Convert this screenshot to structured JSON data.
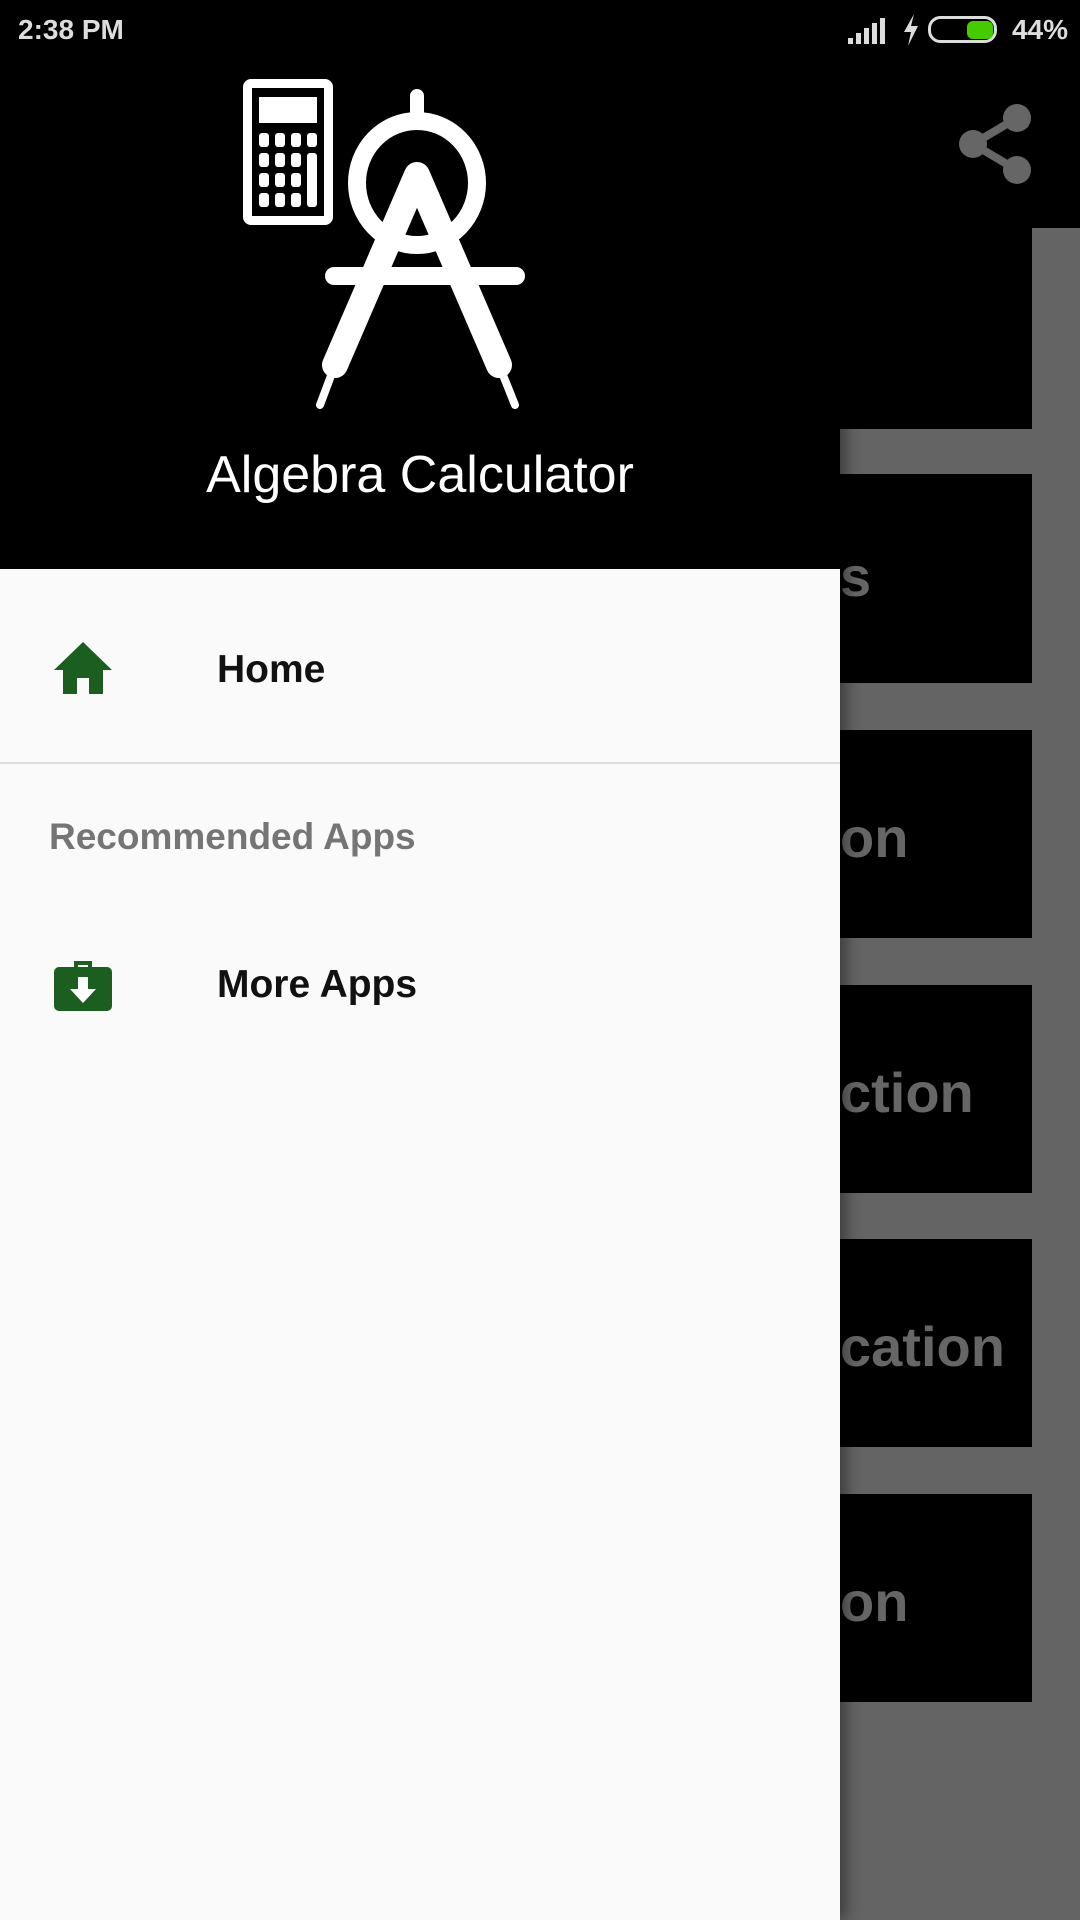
{
  "status_bar": {
    "time": "2:38 PM",
    "battery": "44%",
    "battery_level": 0.44,
    "battery_color": "#44cc00"
  },
  "background": {
    "share_icon": "share-icon",
    "cards": [
      {
        "text": ""
      },
      {
        "text": "s"
      },
      {
        "text": "on"
      },
      {
        "text": "ction"
      },
      {
        "text": "cation"
      },
      {
        "text": "on"
      }
    ]
  },
  "drawer": {
    "app_title": "Algebra Calculator",
    "logo": "calculator-compass-logo",
    "items": [
      {
        "label": "Home",
        "icon": "home-icon"
      }
    ],
    "section_title": "Recommended Apps",
    "section_items": [
      {
        "label": "More Apps",
        "icon": "download-briefcase-icon"
      }
    ],
    "accent_color": "#1b5e20"
  }
}
